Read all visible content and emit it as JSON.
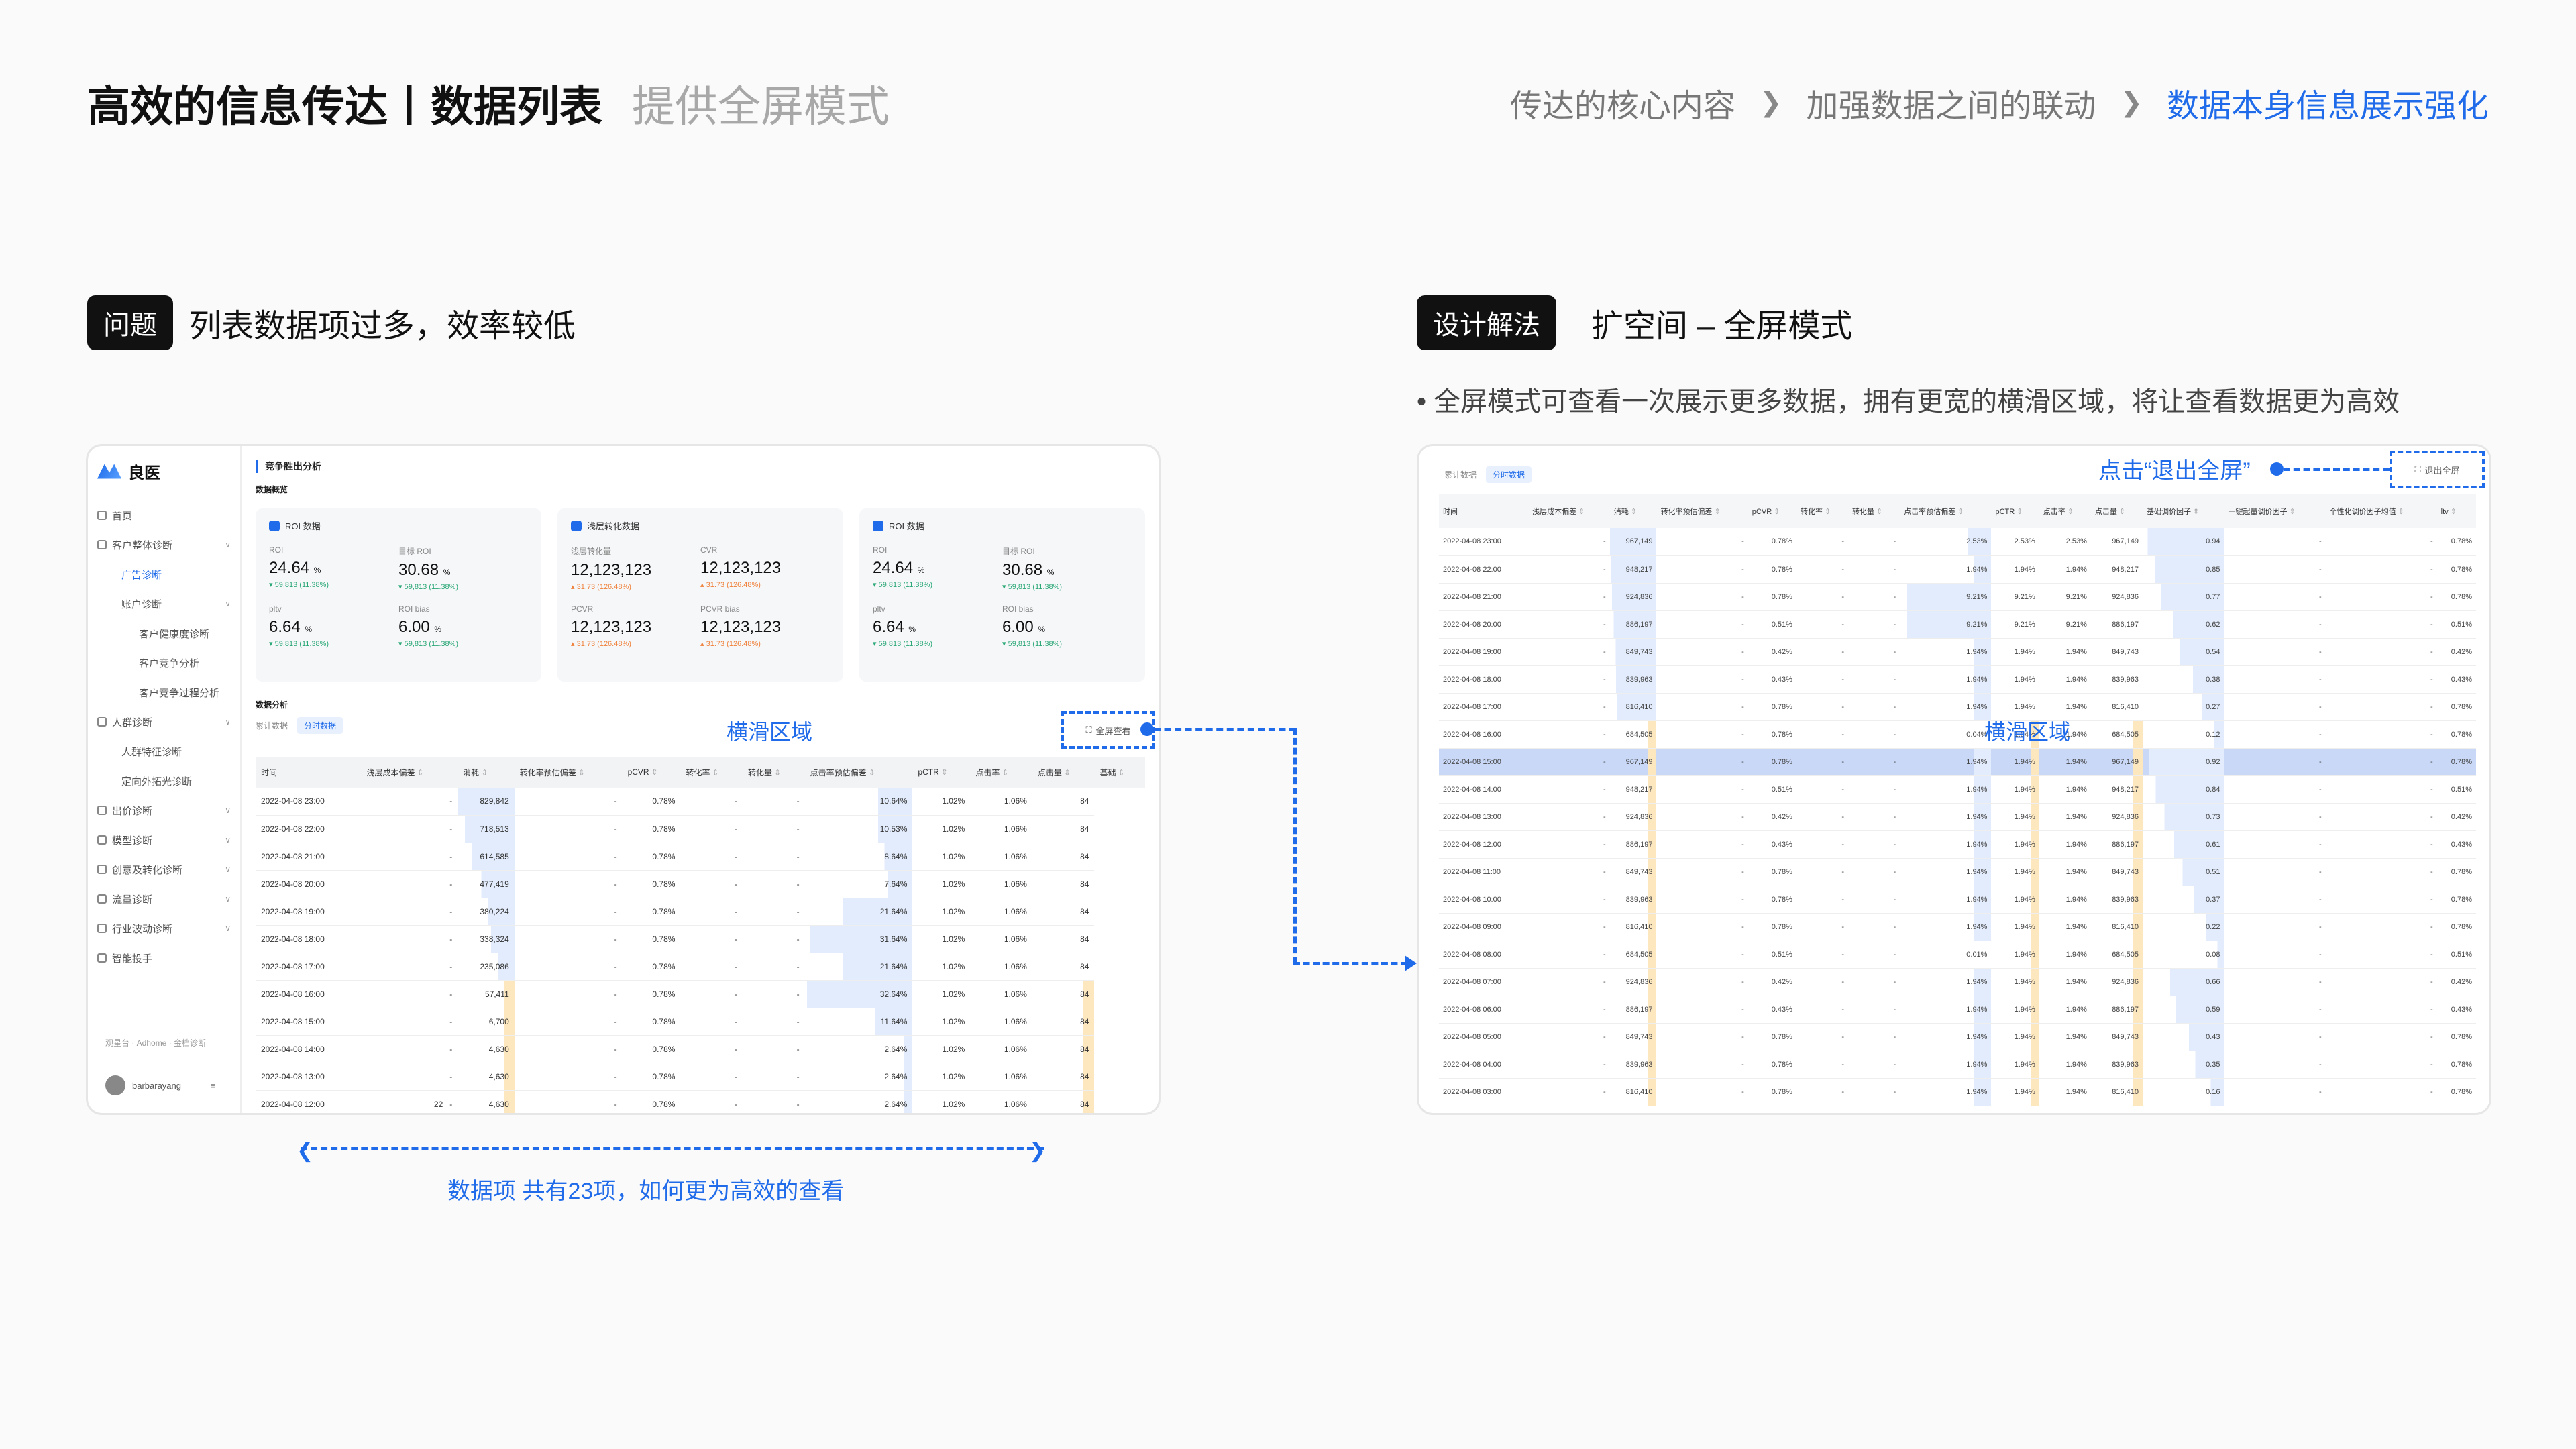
{
  "header": {
    "title": "高效的信息传达丨数据列表",
    "subtitle": "提供全屏模式",
    "breadcrumb": [
      "传达的核心内容",
      "加强数据之间的联动",
      "数据本身信息展示强化"
    ]
  },
  "problem": {
    "tag": "问题",
    "text": "列表数据项过多，效率较低"
  },
  "solution": {
    "tag": "设计解法",
    "text": "扩空间 – 全屏模式",
    "bullet": "• 全屏模式可查看一次展示更多数据，拥有更宽的横滑区域，将让查看数据更为高效"
  },
  "annotations": {
    "scroll_area": "横滑区域",
    "data_items": "数据项 共有23项，如何更为高效的查看",
    "exit_fullscreen": "点击“退出全屏”"
  },
  "left_app": {
    "brand": "良医",
    "nav": [
      {
        "label": "首页",
        "level": 1
      },
      {
        "label": "客户整体诊断",
        "level": 1,
        "chevron": true
      },
      {
        "label": "广告诊断",
        "level": 2,
        "active": true
      },
      {
        "label": "账户诊断",
        "level": 2,
        "chevron": true
      },
      {
        "label": "客户健康度诊断",
        "level": 3
      },
      {
        "label": "客户竞争分析",
        "level": 3
      },
      {
        "label": "客户竞争过程分析",
        "level": 3
      },
      {
        "label": "人群诊断",
        "level": 1,
        "chevron": true
      },
      {
        "label": "人群特征诊断",
        "level": 2
      },
      {
        "label": "定向外拓光诊断",
        "level": 2
      },
      {
        "label": "出价诊断",
        "level": 1,
        "chevron": true
      },
      {
        "label": "模型诊断",
        "level": 1,
        "chevron": true
      },
      {
        "label": "创意及转化诊断",
        "level": 1,
        "chevron": true
      },
      {
        "label": "流量诊断",
        "level": 1,
        "chevron": true
      },
      {
        "label": "行业波动诊断",
        "level": 1,
        "chevron": true
      },
      {
        "label": "智能投手",
        "level": 1
      }
    ],
    "footer_links": "观星台 · Adhome · 金档诊断",
    "username": "barbarayang",
    "page_heading": "竞争胜出分析",
    "overview_label": "数据概览",
    "cards": [
      {
        "title": "ROI 数据",
        "metrics": [
          {
            "label": "ROI",
            "value": "24.64",
            "unit": "%",
            "change": "▾ 59,813 (11.38%)",
            "up": false
          },
          {
            "label": "目标 ROI",
            "value": "30.68",
            "unit": "%",
            "change": "▾ 59,813 (11.38%)",
            "up": false
          },
          {
            "label": "pltv",
            "value": "6.64",
            "unit": "%",
            "change": "▾ 59,813 (11.38%)",
            "up": false
          },
          {
            "label": "ROI bias",
            "value": "6.00",
            "unit": "%",
            "change": "▾ 59,813 (11.38%)",
            "up": false
          }
        ]
      },
      {
        "title": "浅层转化数据",
        "metrics": [
          {
            "label": "浅层转化量",
            "value": "12,123,123",
            "unit": "",
            "change": "▴ 31.73 (126.48%)",
            "up": true
          },
          {
            "label": "CVR",
            "value": "12,123,123",
            "unit": "",
            "change": "▴ 31.73 (126.48%)",
            "up": true
          },
          {
            "label": "PCVR",
            "value": "12,123,123",
            "unit": "",
            "change": "▴ 31.73 (126.48%)",
            "up": true
          },
          {
            "label": "PCVR bias",
            "value": "12,123,123",
            "unit": "",
            "change": "▴ 31.73 (126.48%)",
            "up": true
          }
        ]
      },
      {
        "title": "ROI 数据",
        "metrics": [
          {
            "label": "ROI",
            "value": "24.64",
            "unit": "%",
            "change": "▾ 59,813 (11.38%)",
            "up": false
          },
          {
            "label": "目标 ROI",
            "value": "30.68",
            "unit": "%",
            "change": "▾ 59,813 (11.38%)",
            "up": false
          },
          {
            "label": "pltv",
            "value": "6.64",
            "unit": "%",
            "change": "▾ 59,813 (11.38%)",
            "up": false
          },
          {
            "label": "ROI bias",
            "value": "6.00",
            "unit": "%",
            "change": "▾ 59,813 (11.38%)",
            "up": false
          }
        ]
      }
    ],
    "analysis_label": "数据分析",
    "tabs": [
      "累计数据",
      "分时数据"
    ],
    "fullscreen_label": "全屏查看",
    "columns": [
      "时间",
      "浅层成本偏差",
      "消耗",
      "转化率预估偏差",
      "pCVR",
      "转化率",
      "转化量",
      "点击率预估偏差",
      "pCTR",
      "点击率",
      "点击量",
      "基础"
    ],
    "rows": [
      [
        "2022-04-08 23:00",
        "-",
        "829,842",
        "-",
        "0.78%",
        "-",
        "-",
        "10.64%",
        "1.02%",
        "1.06%",
        "84"
      ],
      [
        "2022-04-08 22:00",
        "-",
        "718,513",
        "-",
        "0.78%",
        "-",
        "-",
        "10.53%",
        "1.02%",
        "1.06%",
        "84"
      ],
      [
        "2022-04-08 21:00",
        "-",
        "614,585",
        "-",
        "0.78%",
        "-",
        "-",
        "8.64%",
        "1.02%",
        "1.06%",
        "84"
      ],
      [
        "2022-04-08 20:00",
        "-",
        "477,419",
        "-",
        "0.78%",
        "-",
        "-",
        "7.64%",
        "1.02%",
        "1.06%",
        "84"
      ],
      [
        "2022-04-08 19:00",
        "-",
        "380,224",
        "-",
        "0.78%",
        "-",
        "-",
        "21.64%",
        "1.02%",
        "1.06%",
        "84"
      ],
      [
        "2022-04-08 18:00",
        "-",
        "338,324",
        "-",
        "0.78%",
        "-",
        "-",
        "31.64%",
        "1.02%",
        "1.06%",
        "84"
      ],
      [
        "2022-04-08 17:00",
        "-",
        "235,086",
        "-",
        "0.78%",
        "-",
        "-",
        "21.64%",
        "1.02%",
        "1.06%",
        "84"
      ],
      [
        "2022-04-08 16:00",
        "-",
        "57,411",
        "-",
        "0.78%",
        "-",
        "-",
        "32.64%",
        "1.02%",
        "1.06%",
        "84"
      ],
      [
        "2022-04-08 15:00",
        "-",
        "6,700",
        "-",
        "0.78%",
        "-",
        "-",
        "11.64%",
        "1.02%",
        "1.06%",
        "84"
      ],
      [
        "2022-04-08 14:00",
        "-",
        "4,630",
        "-",
        "0.78%",
        "-",
        "-",
        "2.64%",
        "1.02%",
        "1.06%",
        "84"
      ],
      [
        "2022-04-08 13:00",
        "-",
        "4,630",
        "-",
        "0.78%",
        "-",
        "-",
        "2.64%",
        "1.02%",
        "1.06%",
        "84"
      ],
      [
        "2022-04-08 12:00",
        "-",
        "4,630",
        "-",
        "0.78%",
        "-",
        "-",
        "2.64%",
        "1.02%",
        "1.06%",
        "84"
      ]
    ],
    "row_badge": "22"
  },
  "right_app": {
    "tabs": [
      "累计数据",
      "分时数据"
    ],
    "exit_label": "退出全屏",
    "columns": [
      "时间",
      "浅层成本偏差",
      "消耗",
      "转化率预估偏差",
      "pCVR",
      "转化率",
      "转化量",
      "点击率预估偏差",
      "pCTR",
      "点击率",
      "点击量",
      "基础调价因子",
      "一键起量调价因子",
      "个性化调价因子均值",
      "ltv"
    ],
    "rows": [
      [
        "2022-04-08 23:00",
        "-",
        "967,149",
        "-",
        "0.78%",
        "-",
        "-",
        "2.53%",
        "2.53%",
        "2.53%",
        "967,149",
        "0.94",
        "-",
        "-",
        "0.78%"
      ],
      [
        "2022-04-08 22:00",
        "-",
        "948,217",
        "-",
        "0.78%",
        "-",
        "-",
        "1.94%",
        "1.94%",
        "1.94%",
        "948,217",
        "0.85",
        "-",
        "-",
        "0.78%"
      ],
      [
        "2022-04-08 21:00",
        "-",
        "924,836",
        "-",
        "0.78%",
        "-",
        "-",
        "9.21%",
        "9.21%",
        "9.21%",
        "924,836",
        "0.77",
        "-",
        "-",
        "0.78%"
      ],
      [
        "2022-04-08 20:00",
        "-",
        "886,197",
        "-",
        "0.51%",
        "-",
        "-",
        "9.21%",
        "9.21%",
        "9.21%",
        "886,197",
        "0.62",
        "-",
        "-",
        "0.51%"
      ],
      [
        "2022-04-08 19:00",
        "-",
        "849,743",
        "-",
        "0.42%",
        "-",
        "-",
        "1.94%",
        "1.94%",
        "1.94%",
        "849,743",
        "0.54",
        "-",
        "-",
        "0.42%"
      ],
      [
        "2022-04-08 18:00",
        "-",
        "839,963",
        "-",
        "0.43%",
        "-",
        "-",
        "1.94%",
        "1.94%",
        "1.94%",
        "839,963",
        "0.38",
        "-",
        "-",
        "0.43%"
      ],
      [
        "2022-04-08 17:00",
        "-",
        "816,410",
        "-",
        "0.78%",
        "-",
        "-",
        "1.94%",
        "1.94%",
        "1.94%",
        "816,410",
        "0.27",
        "-",
        "-",
        "0.78%"
      ],
      [
        "2022-04-08 16:00",
        "-",
        "684,505",
        "-",
        "0.78%",
        "-",
        "-",
        "0.04%",
        "1.94%",
        "1.94%",
        "684,505",
        "0.12",
        "-",
        "-",
        "0.78%"
      ],
      [
        "2022-04-08 15:00",
        "-",
        "967,149",
        "-",
        "0.78%",
        "-",
        "-",
        "1.94%",
        "1.94%",
        "1.94%",
        "967,149",
        "0.92",
        "-",
        "-",
        "0.78%"
      ],
      [
        "2022-04-08 14:00",
        "-",
        "948,217",
        "-",
        "0.51%",
        "-",
        "-",
        "1.94%",
        "1.94%",
        "1.94%",
        "948,217",
        "0.84",
        "-",
        "-",
        "0.51%"
      ],
      [
        "2022-04-08 13:00",
        "-",
        "924,836",
        "-",
        "0.42%",
        "-",
        "-",
        "1.94%",
        "1.94%",
        "1.94%",
        "924,836",
        "0.73",
        "-",
        "-",
        "0.42%"
      ],
      [
        "2022-04-08 12:00",
        "-",
        "886,197",
        "-",
        "0.43%",
        "-",
        "-",
        "1.94%",
        "1.94%",
        "1.94%",
        "886,197",
        "0.61",
        "-",
        "-",
        "0.43%"
      ],
      [
        "2022-04-08 11:00",
        "-",
        "849,743",
        "-",
        "0.78%",
        "-",
        "-",
        "1.94%",
        "1.94%",
        "1.94%",
        "849,743",
        "0.51",
        "-",
        "-",
        "0.78%"
      ],
      [
        "2022-04-08 10:00",
        "-",
        "839,963",
        "-",
        "0.78%",
        "-",
        "-",
        "1.94%",
        "1.94%",
        "1.94%",
        "839,963",
        "0.37",
        "-",
        "-",
        "0.78%"
      ],
      [
        "2022-04-08 09:00",
        "-",
        "816,410",
        "-",
        "0.78%",
        "-",
        "-",
        "1.94%",
        "1.94%",
        "1.94%",
        "816,410",
        "0.22",
        "-",
        "-",
        "0.78%"
      ],
      [
        "2022-04-08 08:00",
        "-",
        "684,505",
        "-",
        "0.51%",
        "-",
        "-",
        "0.01%",
        "1.94%",
        "1.94%",
        "684,505",
        "0.08",
        "-",
        "-",
        "0.51%"
      ],
      [
        "2022-04-08 07:00",
        "-",
        "924,836",
        "-",
        "0.42%",
        "-",
        "-",
        "1.94%",
        "1.94%",
        "1.94%",
        "924,836",
        "0.66",
        "-",
        "-",
        "0.42%"
      ],
      [
        "2022-04-08 06:00",
        "-",
        "886,197",
        "-",
        "0.43%",
        "-",
        "-",
        "1.94%",
        "1.94%",
        "1.94%",
        "886,197",
        "0.59",
        "-",
        "-",
        "0.43%"
      ],
      [
        "2022-04-08 05:00",
        "-",
        "849,743",
        "-",
        "0.78%",
        "-",
        "-",
        "1.94%",
        "1.94%",
        "1.94%",
        "849,743",
        "0.43",
        "-",
        "-",
        "0.78%"
      ],
      [
        "2022-04-08 04:00",
        "-",
        "839,963",
        "-",
        "0.78%",
        "-",
        "-",
        "1.94%",
        "1.94%",
        "1.94%",
        "839,963",
        "0.35",
        "-",
        "-",
        "0.78%"
      ],
      [
        "2022-04-08 03:00",
        "-",
        "816,410",
        "-",
        "0.78%",
        "-",
        "-",
        "1.94%",
        "1.94%",
        "1.94%",
        "816,410",
        "0.16",
        "-",
        "-",
        "0.78%"
      ]
    ]
  },
  "colors": {
    "accent": "#1f6bea",
    "highlight_row": "#c9d8f7",
    "bar_blue": "#e3ecfc",
    "bar_orange": "#fde7bf"
  }
}
